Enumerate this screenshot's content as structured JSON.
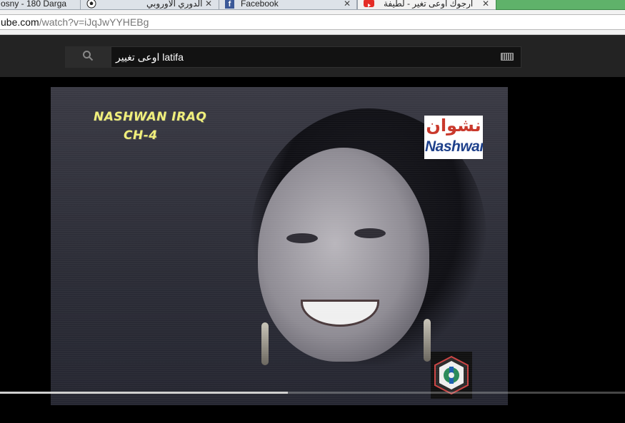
{
  "tabs": [
    {
      "label": "osny - 180 Darga",
      "icon": "page-icon",
      "active": false
    },
    {
      "label": "الدوري الاوروبي",
      "icon": "soccer-ball-icon",
      "active": false
    },
    {
      "label": "Facebook",
      "icon": "facebook-icon",
      "active": false
    },
    {
      "label": "ارجوك اوعى تغير - لطيفة",
      "icon": "youtube-icon",
      "active": true
    }
  ],
  "address": {
    "url_host": "ube.com",
    "url_path": "/watch?v=iJqJwYYHEBg"
  },
  "search": {
    "query": "اوعى تغيير latifa",
    "icon": "search-icon",
    "keyboard_icon": "keyboard-icon"
  },
  "video": {
    "watermark_line1": "NASHWAN IRAQ",
    "watermark_line2": "CH-4",
    "logo_arabic": "نشوان",
    "logo_english": "Nashwan",
    "progress": 0.46
  },
  "colors": {
    "masthead": "#232323",
    "watermark_text": "#f0ef7a",
    "logo_red": "#c9372a",
    "logo_blue": "#1c3f8a"
  }
}
